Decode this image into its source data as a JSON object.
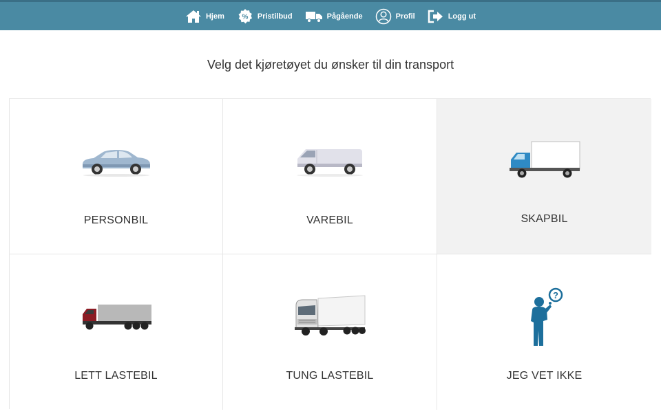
{
  "nav": {
    "items": [
      {
        "label": "Hjem",
        "icon": "home-icon"
      },
      {
        "label": "Pristilbud",
        "icon": "percent-icon"
      },
      {
        "label": "Pågående",
        "icon": "truck-icon"
      },
      {
        "label": "Profil",
        "icon": "user-icon"
      },
      {
        "label": "Logg ut",
        "icon": "logout-icon"
      }
    ]
  },
  "main": {
    "heading": "Velg det kjøretøyet du ønsker til din transport",
    "vehicles": [
      {
        "label": "PERSONBIL",
        "icon": "car-icon",
        "selected": false
      },
      {
        "label": "VAREBIL",
        "icon": "van-icon",
        "selected": false
      },
      {
        "label": "SKAPBIL",
        "icon": "box-truck-icon",
        "selected": true
      },
      {
        "label": "LETT LASTEBIL",
        "icon": "light-truck-icon",
        "selected": false
      },
      {
        "label": "TUNG LASTEBIL",
        "icon": "heavy-truck-icon",
        "selected": false
      },
      {
        "label": "JEG VET IKKE",
        "icon": "unsure-person-icon",
        "selected": false
      }
    ]
  },
  "colors": {
    "topbar": "#4a8aa3",
    "selected_tile": "#f2f2f2"
  }
}
